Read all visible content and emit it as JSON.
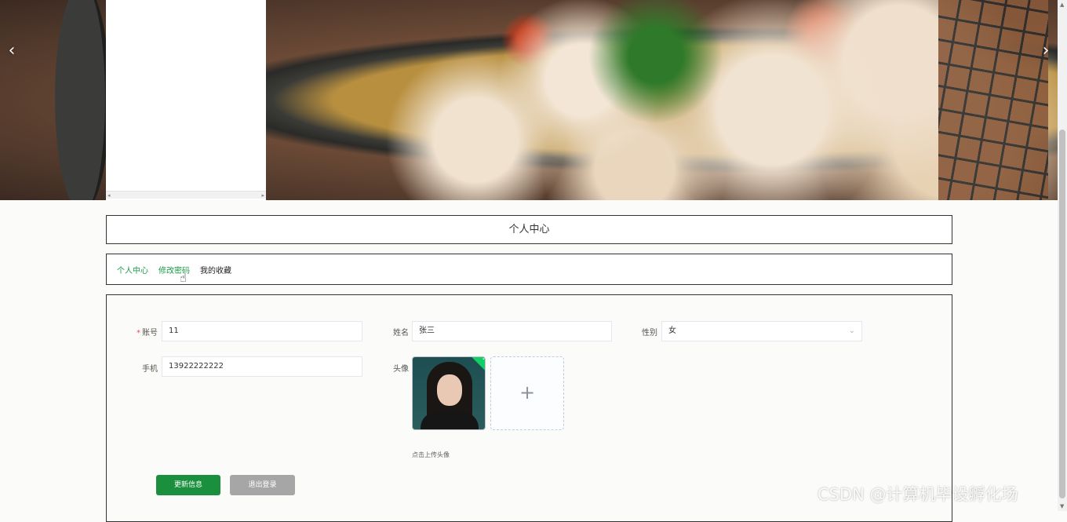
{
  "banner": {
    "prev_arrow": "‹",
    "next_arrow": "›",
    "scroll_left": "◂",
    "scroll_right": "▸"
  },
  "page_title": "个人中心",
  "tabs": [
    {
      "label": "个人中心"
    },
    {
      "label": "修改密码"
    },
    {
      "label": "我的收藏"
    }
  ],
  "form": {
    "account": {
      "label": "账号",
      "required_mark": "*",
      "value": "11"
    },
    "name": {
      "label": "姓名",
      "value": "张三"
    },
    "gender": {
      "label": "性别",
      "value": "女"
    },
    "phone": {
      "label": "手机",
      "value": "13922222222"
    },
    "avatar": {
      "label": "头像",
      "add_symbol": "+",
      "tip": "点击上传头像",
      "uploaded_mark": "✓"
    }
  },
  "buttons": {
    "update": "更新信息",
    "logout": "退出登录"
  },
  "watermark": "CSDN @计算机毕设孵化场",
  "colors": {
    "accent_green": "#1a8f3e",
    "tab_green": "#199a48",
    "gray_button": "#a6a6a6",
    "required_red": "#e05555"
  }
}
